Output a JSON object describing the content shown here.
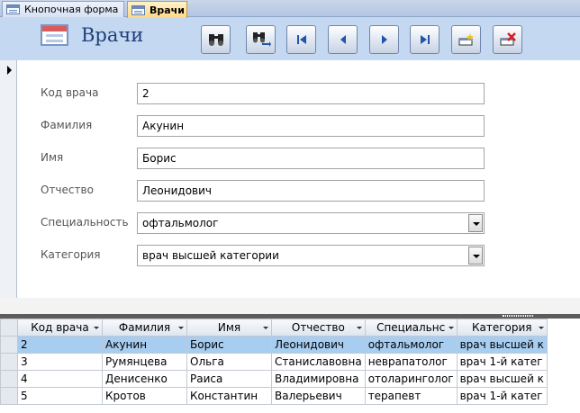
{
  "tabs": [
    {
      "label": "Кнопочная форма",
      "active": false
    },
    {
      "label": "Врачи",
      "active": true
    }
  ],
  "header": {
    "title": "Врачи",
    "buttons": [
      {
        "name": "find-button",
        "icon": "binoculars-icon"
      },
      {
        "name": "find-next-button",
        "icon": "binoculars-next-icon"
      },
      {
        "name": "first-record-button",
        "icon": "first-record-icon"
      },
      {
        "name": "previous-record-button",
        "icon": "previous-record-icon"
      },
      {
        "name": "next-record-button",
        "icon": "next-record-icon"
      },
      {
        "name": "last-record-button",
        "icon": "last-record-icon"
      },
      {
        "name": "new-record-button",
        "icon": "new-record-icon"
      },
      {
        "name": "delete-record-button",
        "icon": "delete-record-icon"
      }
    ]
  },
  "form": {
    "fields": [
      {
        "label": "Код врача",
        "value": "2",
        "type": "text"
      },
      {
        "label": "Фамилия",
        "value": "Акунин",
        "type": "text"
      },
      {
        "label": "Имя",
        "value": "Борис",
        "type": "text"
      },
      {
        "label": "Отчество",
        "value": "Леонидович",
        "type": "text"
      },
      {
        "label": "Специальность",
        "value": "офтальмолог",
        "type": "combo"
      },
      {
        "label": "Категория",
        "value": "врач высшей категории",
        "type": "combo"
      }
    ]
  },
  "datasheet": {
    "columns": [
      "Код врача",
      "Фамилия",
      "Имя",
      "Отчество",
      "Специальнс",
      "Категория"
    ],
    "rows": [
      [
        "2",
        "Акунин",
        "Борис",
        "Леонидович",
        "офтальмолог",
        "врач высшей к"
      ],
      [
        "3",
        "Румянцева",
        "Ольга",
        "Станиславовна",
        "неврапатолог",
        "врач 1-й катег"
      ],
      [
        "4",
        "Денисенко",
        "Раиса",
        "Владимировна",
        "отоларинголог",
        "врач высшей к"
      ],
      [
        "5",
        "Кротов",
        "Константин",
        "Валерьевич",
        "терапевт",
        "врач 1-й катег"
      ]
    ],
    "current_row": 0
  },
  "colors": {
    "header_bg": "#c5d8f1",
    "title_color": "#1f3f7a",
    "active_tab": "#ffd783",
    "selected_row": "#a7cdf0"
  }
}
